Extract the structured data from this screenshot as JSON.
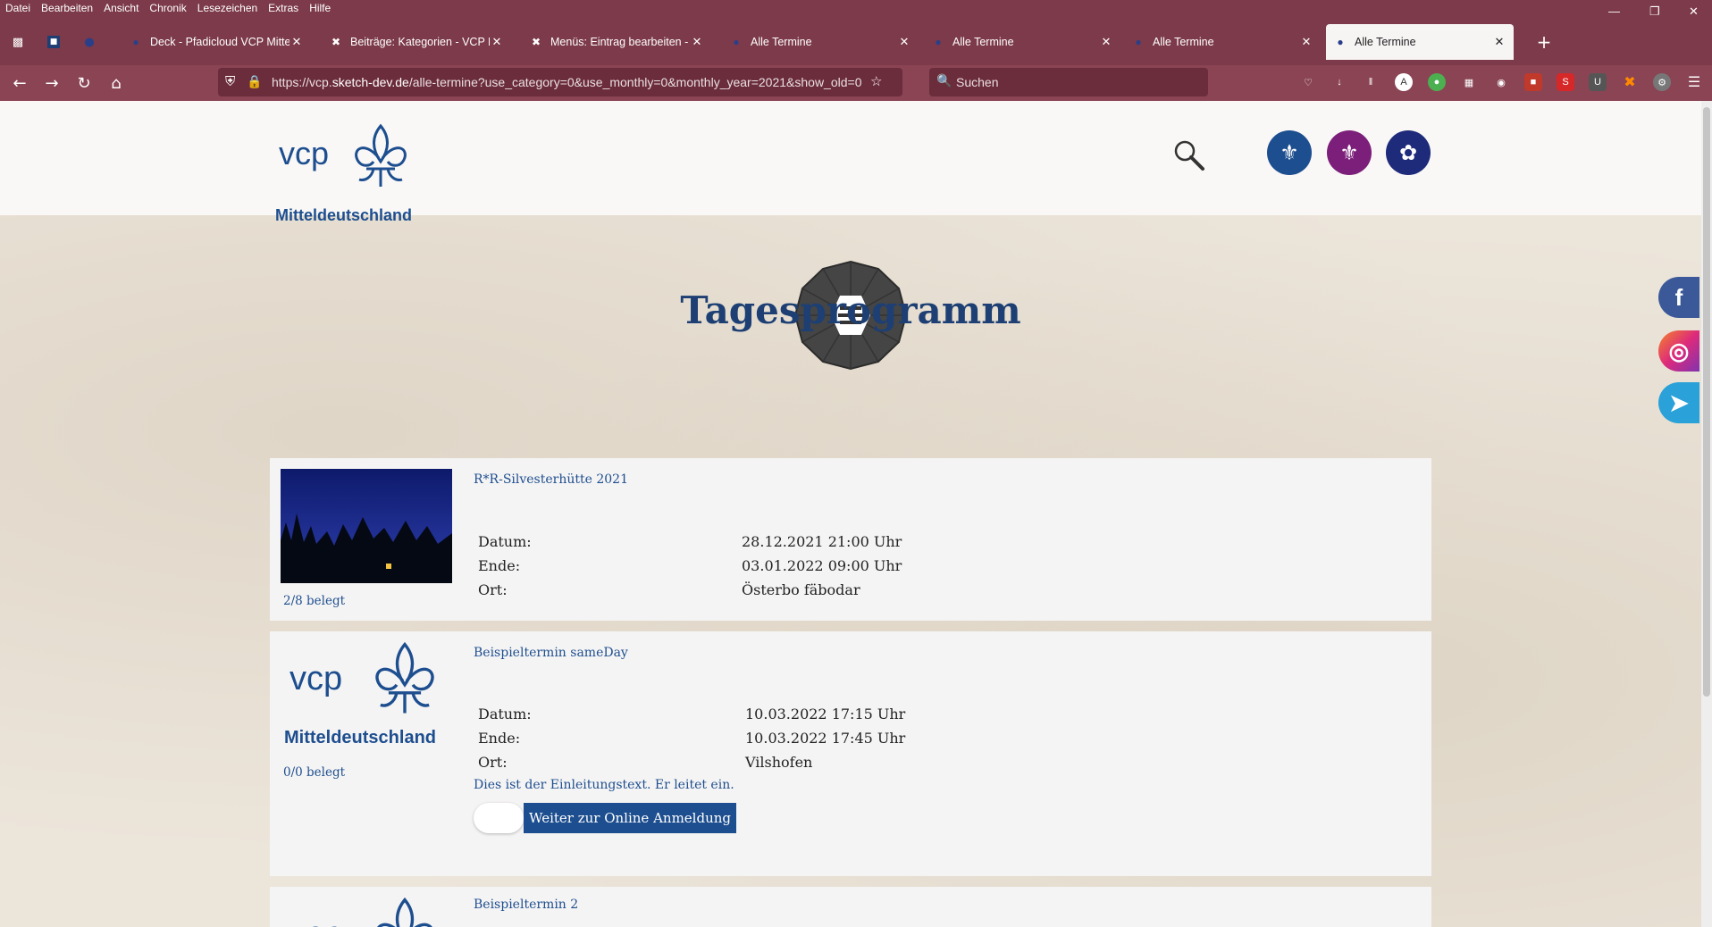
{
  "menubar": {
    "items": [
      "Datei",
      "Bearbeiten",
      "Ansicht",
      "Chronik",
      "Lesezeichen",
      "Extras",
      "Hilfe"
    ]
  },
  "tabs": [
    {
      "label": "Deck - Pfadicloud VCP Mitteldeu",
      "icon": "app-icon"
    },
    {
      "label": "Beiträge: Kategorien - VCP Mitt",
      "icon": "joomla-icon"
    },
    {
      "label": "Menüs: Eintrag bearbeiten - VCP",
      "icon": "joomla-icon"
    },
    {
      "label": "Alle Termine",
      "icon": "vcp-icon"
    },
    {
      "label": "Alle Termine",
      "icon": "vcp-icon"
    },
    {
      "label": "Alle Termine",
      "icon": "vcp-icon"
    },
    {
      "label": "Alle Termine",
      "icon": "vcp-icon",
      "active": true
    }
  ],
  "urlbar": {
    "prefix": "https://vcp.",
    "domain": "sketch-dev.de",
    "path": "/alle-termine?use_category=0&use_monthly=0&monthly_year=2021&show_old=0"
  },
  "search": {
    "placeholder": "Suchen"
  },
  "header": {
    "logo_word": "vcp",
    "logo_region": "Mitteldeutschland"
  },
  "page": {
    "title": "Tagesprogramm"
  },
  "labels": {
    "date": "Datum:",
    "end": "Ende:",
    "place": "Ort:"
  },
  "events": [
    {
      "title": "R*R-Silvesterhütte 2021",
      "date": "28.12.2021 21:00 Uhr",
      "end": "03.01.2022 09:00 Uhr",
      "place": "Österbo fäbodar",
      "occupancy": "2/8 belegt"
    },
    {
      "title": "Beispieltermin sameDay",
      "date": "10.03.2022 17:15 Uhr",
      "end": "10.03.2022 17:45 Uhr",
      "place": "Vilshofen",
      "occupancy": "0/0 belegt",
      "intro": "Dies ist der Einleitungstext. Er leitet ein.",
      "button": "Weiter zur Online Anmeldung"
    },
    {
      "title": "Beispieltermin 2"
    }
  ],
  "colors": {
    "brand_blue": "#1d4e8f",
    "chrome": "#7c3a4a",
    "facebook": "#3b5998",
    "instagram": "#c13584",
    "telegram": "#2aa1d8"
  }
}
